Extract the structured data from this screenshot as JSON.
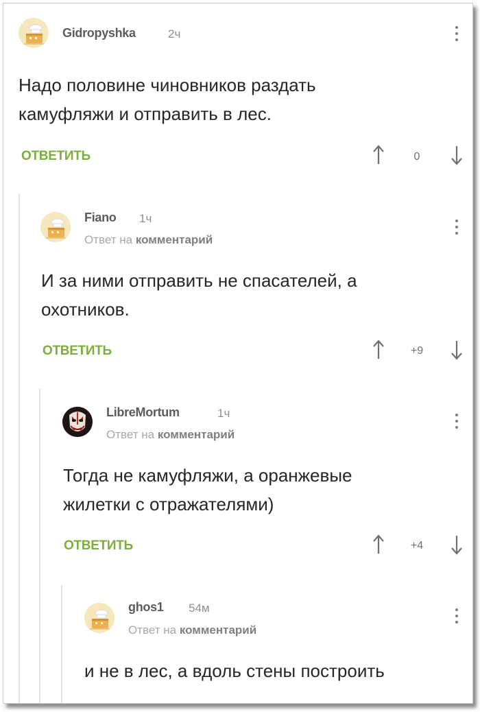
{
  "ui": {
    "reply_prefix": "Ответ на",
    "reply_target": "комментарий",
    "reply_label": "ОТВЕТИТЬ"
  },
  "comments": [
    {
      "author": "Gidropyshka",
      "time": "2ч",
      "text_lines": [
        "Надо половине чиновников раздать",
        "камуфляжи и отправить в лес."
      ],
      "score": "0",
      "avatar": "default-chef-avatar"
    },
    {
      "author": "Fiano",
      "time": "1ч",
      "text_lines": [
        "И за ними отправить не спасателей, а",
        "охотников."
      ],
      "score": "+9",
      "avatar": "default-chef-avatar"
    },
    {
      "author": "LibreMortum",
      "time": "1ч",
      "text_lines": [
        "Тогда не камуфляжи, а оранжевые",
        "жилетки с отражателями)"
      ],
      "score": "+4",
      "avatar": "masked-face-avatar"
    },
    {
      "author": "ghos1",
      "time": "54м",
      "text_lines": [
        "и не в лес, а вдоль стены построить"
      ],
      "avatar": "default-chef-avatar"
    }
  ],
  "colors": {
    "accent_green": "#7aae3d",
    "text": "#262626",
    "muted": "#a7a7a7",
    "thread_line": "#e3e3e3"
  }
}
